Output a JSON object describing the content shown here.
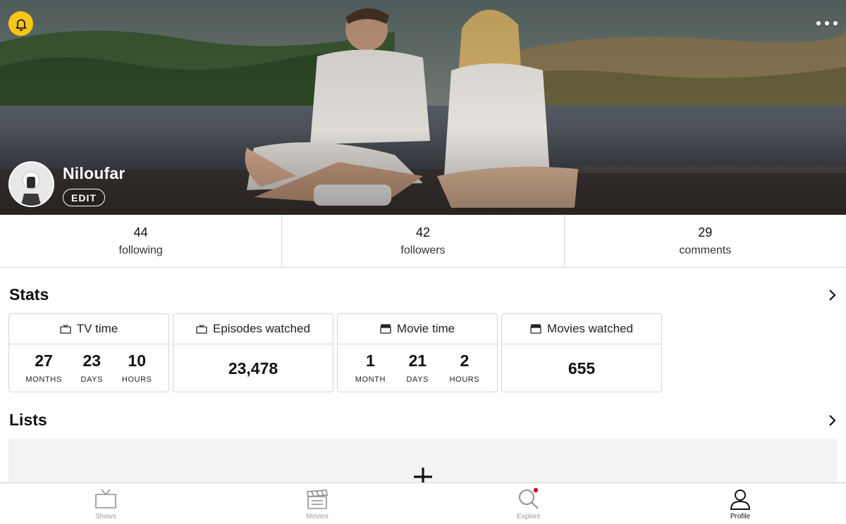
{
  "profile": {
    "username": "Niloufar",
    "edit_label": "EDIT"
  },
  "icons": {
    "notifications": "bell-icon",
    "more": "more-dots-icon",
    "stats_chevron": "chevron-right-icon",
    "lists_chevron": "chevron-right-icon",
    "add_list": "plus-icon"
  },
  "colors": {
    "accent": "#f5c518",
    "notification_dot": "#d0021b"
  },
  "social": [
    {
      "value": "44",
      "label": "following"
    },
    {
      "value": "42",
      "label": "followers"
    },
    {
      "value": "29",
      "label": "comments"
    }
  ],
  "stats": {
    "title": "Stats",
    "tv_time": {
      "label": "TV time",
      "icon": "tv-icon",
      "units": [
        {
          "value": "27",
          "label": "MONTHS"
        },
        {
          "value": "23",
          "label": "DAYS"
        },
        {
          "value": "10",
          "label": "HOURS"
        }
      ]
    },
    "episodes": {
      "label": "Episodes watched",
      "icon": "tv-icon",
      "value": "23,478"
    },
    "movie_time": {
      "label": "Movie time",
      "icon": "clapper-icon",
      "units": [
        {
          "value": "1",
          "label": "MONTH"
        },
        {
          "value": "21",
          "label": "DAYS"
        },
        {
          "value": "2",
          "label": "HOURS"
        }
      ]
    },
    "movies": {
      "label": "Movies watched",
      "icon": "clapper-icon",
      "value": "655"
    }
  },
  "lists": {
    "title": "Lists"
  },
  "tabs": [
    {
      "label": "Shows",
      "icon": "tv-icon",
      "active": false
    },
    {
      "label": "Movies",
      "icon": "clapper-icon",
      "active": false
    },
    {
      "label": "Explore",
      "icon": "search-icon",
      "active": false,
      "badge": true
    },
    {
      "label": "Profile",
      "icon": "user-icon",
      "active": true
    }
  ]
}
